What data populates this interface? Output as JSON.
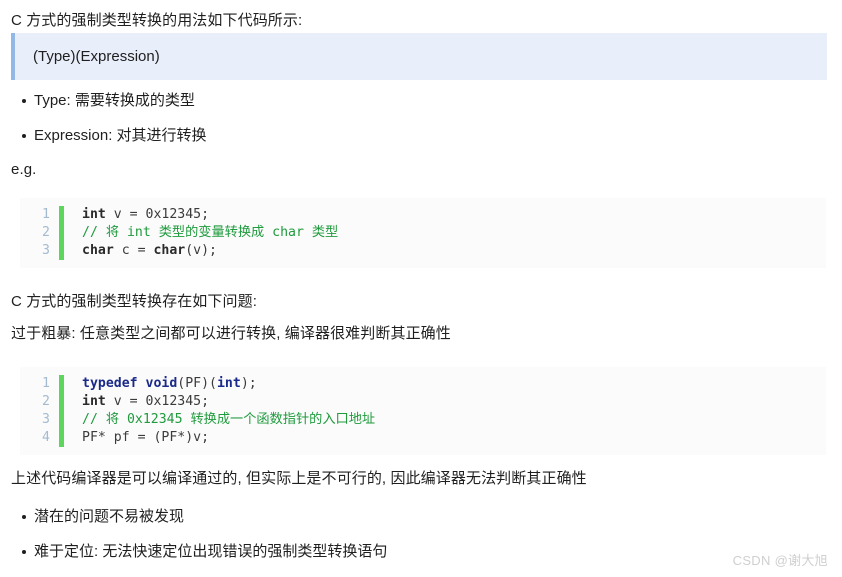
{
  "intro_paragraph": "C 方式的强制类型转换的用法如下代码所示:",
  "blockquote": "(Type)(Expression)",
  "definition_list": [
    "Type: 需要转换成的类型",
    "Expression: 对其进行转换"
  ],
  "eg_label": "e.g.",
  "code_block_1": {
    "lines": [
      {
        "number": "1",
        "tokens": [
          {
            "text": "int",
            "style": "kw-bold"
          },
          {
            "text": " v = 0x12345;",
            "style": "plain"
          }
        ]
      },
      {
        "number": "2",
        "tokens": [
          {
            "text": "// 将 int 类型的变量转换成 char 类型",
            "style": "cmt"
          }
        ]
      },
      {
        "number": "3",
        "tokens": [
          {
            "text": "char",
            "style": "kw-bold"
          },
          {
            "text": " c = ",
            "style": "plain"
          },
          {
            "text": "char",
            "style": "kw-bold"
          },
          {
            "text": "(v);",
            "style": "plain"
          }
        ]
      }
    ]
  },
  "problem_heading": "C 方式的强制类型转换存在如下问题:",
  "problem_detail": "过于粗暴: 任意类型之间都可以进行转换, 编译器很难判断其正确性",
  "code_block_2": {
    "lines": [
      {
        "number": "1",
        "tokens": [
          {
            "text": "typedef void",
            "style": "kw-blue"
          },
          {
            "text": "(PF)(",
            "style": "plain"
          },
          {
            "text": "int",
            "style": "kw-blue"
          },
          {
            "text": ");",
            "style": "plain"
          }
        ]
      },
      {
        "number": "2",
        "tokens": [
          {
            "text": "int",
            "style": "kw-bold"
          },
          {
            "text": " v = 0x12345;",
            "style": "plain"
          }
        ]
      },
      {
        "number": "3",
        "tokens": [
          {
            "text": "// 将 0x12345 转换成一个函数指针的入口地址",
            "style": "cmt"
          }
        ]
      },
      {
        "number": "4",
        "tokens": [
          {
            "text": "PF* pf = (PF*)v;",
            "style": "plain"
          }
        ]
      }
    ]
  },
  "conclusion": "上述代码编译器是可以编译通过的, 但实际上是不可行的, 因此编译器无法判断其正确性",
  "issue_list": [
    "潜在的问题不易被发现",
    "难于定位: 无法快速定位出现错误的强制类型转换语句"
  ],
  "watermark": "CSDN @谢大旭"
}
